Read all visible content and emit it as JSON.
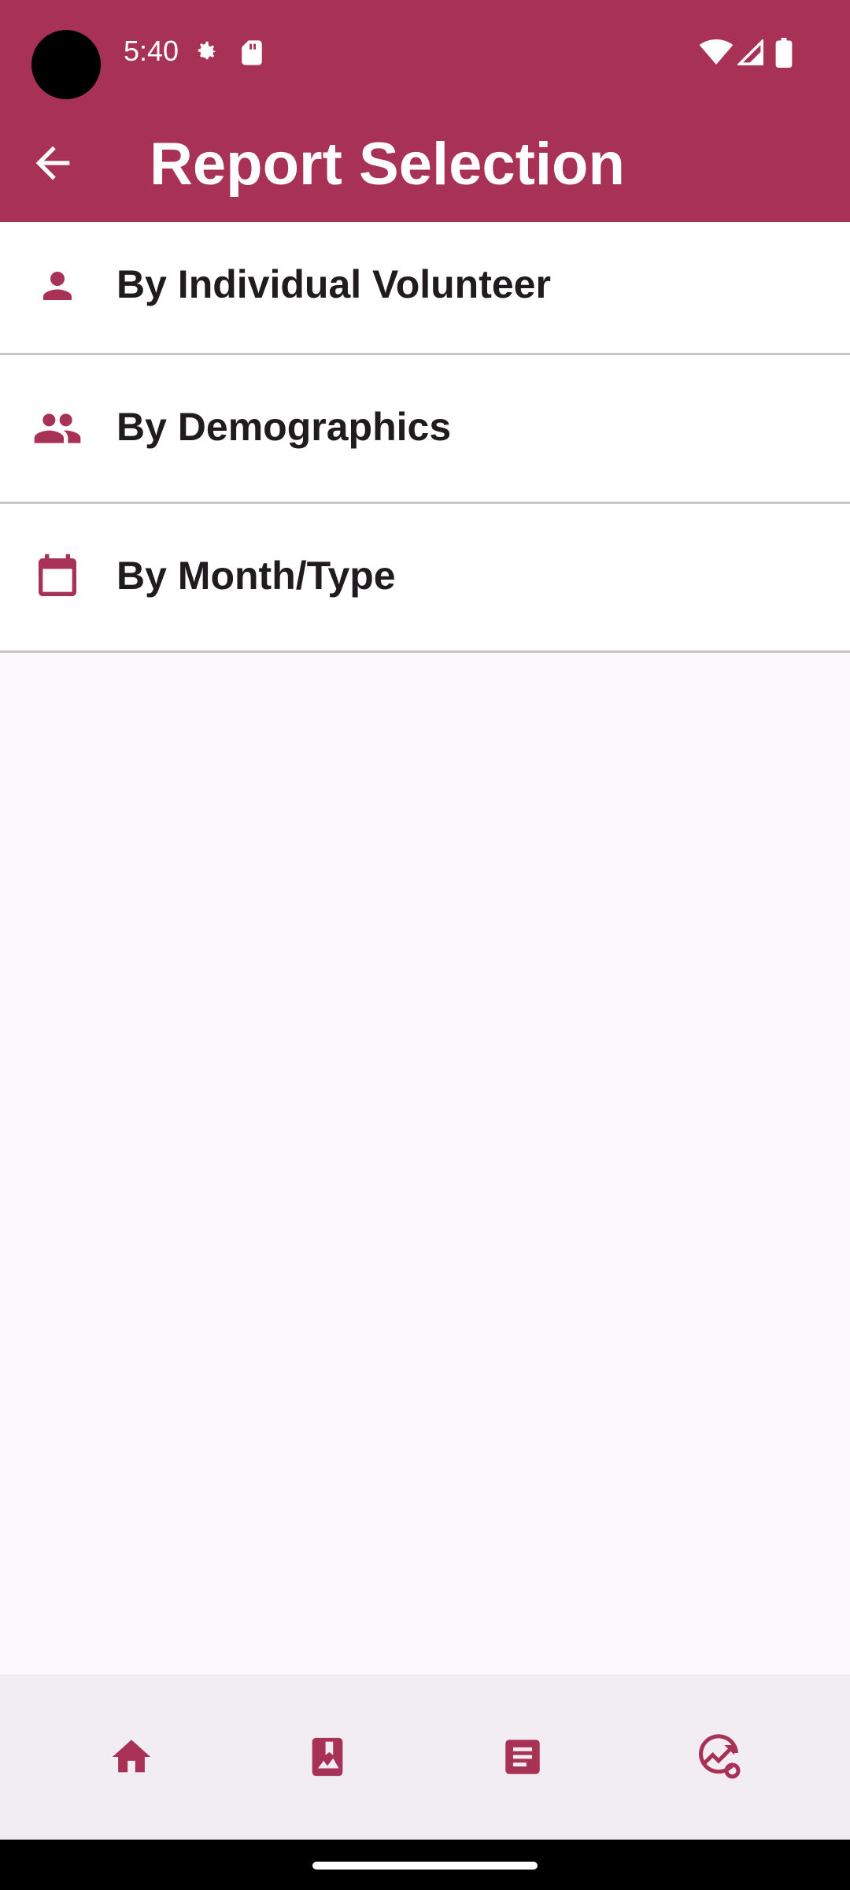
{
  "status_bar": {
    "time": "5:40",
    "icons": [
      "settings-gear-icon",
      "sd-card-icon",
      "wifi-icon",
      "cell-signal-icon",
      "battery-icon"
    ]
  },
  "app_bar": {
    "title": "Report Selection",
    "back_icon": "arrow-back-icon"
  },
  "reports": [
    {
      "label": "By Individual Volunteer",
      "icon": "person-icon"
    },
    {
      "label": "By Demographics",
      "icon": "group-icon"
    },
    {
      "label": "By Month/Type",
      "icon": "calendar-icon"
    }
  ],
  "bottom_nav": {
    "items": [
      {
        "icon": "home-icon"
      },
      {
        "icon": "photo-bookmark-icon"
      },
      {
        "icon": "article-icon"
      },
      {
        "icon": "analytics-icon"
      }
    ]
  },
  "colors": {
    "primary": "#a83256",
    "surface": "#fdf8fb",
    "nav_surface": "#f2edf2",
    "divider": "#c9c5c8",
    "text": "#1f1b1e"
  }
}
